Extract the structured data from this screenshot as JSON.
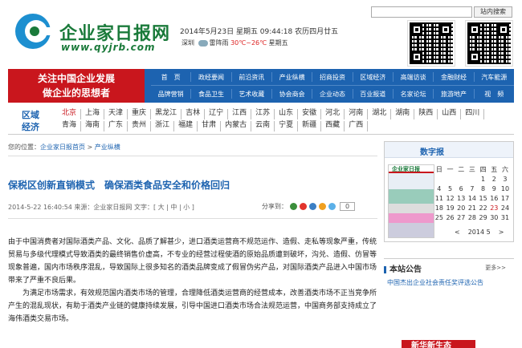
{
  "header": {
    "logo_title": "企业家日报网",
    "logo_url": "www.qyjrb.com",
    "date_line": "2014年5月23日 星期五 09:44:18 农历四月廿五",
    "weather_city": "深圳",
    "weather_desc": "雷阵雨",
    "weather_temp": "30℃~26℃",
    "weather_day": "星期五",
    "search_placeholder": "",
    "search_button": "站内搜索"
  },
  "nav": {
    "slogan_line1": "关注中国企业发展",
    "slogan_line2": "做企业的思想者",
    "row1": [
      "首　页",
      "政经要闻",
      "前沿资讯",
      "产业纵横",
      "招商投资",
      "区域经济",
      "高端访谈",
      "金融财经",
      "汽车能源"
    ],
    "row2": [
      "品牌营销",
      "食品卫生",
      "艺术收藏",
      "协会商会",
      "企业动态",
      "百业报道",
      "名家论坛",
      "旅游地产",
      "视　频"
    ]
  },
  "region": {
    "label_line1": "区域",
    "label_line2": "经济",
    "row1": [
      "北京",
      "上海",
      "天津",
      "重庆",
      "黑龙江",
      "吉林",
      "辽宁",
      "江西",
      "江苏",
      "山东",
      "安徽",
      "河北",
      "河南",
      "湖北",
      "湖南",
      "陕西",
      "山西",
      "四川"
    ],
    "row2": [
      "青海",
      "海南",
      "广东",
      "贵州",
      "浙江",
      "福建",
      "甘肃",
      "内蒙古",
      "云南",
      "宁夏",
      "新疆",
      "西藏",
      "广西"
    ]
  },
  "breadcrumb": {
    "prefix": "您的位置：",
    "home": "企业家日报首页",
    "sep": " > ",
    "section": "产业纵横"
  },
  "article": {
    "title": "保税区创新直销模式　确保酒类食品安全和价格回归",
    "meta": "2014-5-22 16:40:54 来源：企业家日报网 文字：[ 大 | 中 | 小 ]",
    "share_label": "分享到：",
    "share_count": "0",
    "paragraphs": [
      "由于中国消费者对国际酒类产品、文化、品质了解甚少，进口酒类运营商不规范运作、造假、走私等现象严重，传统贸易与多级代理模式导致酒类的最终销售价虚高，不专业的经营过程使酒的原始品质遭到破坏，沟兑、造假、仿冒等现象普遍，国内市场秩序混乱，导致国际上很多知名的酒类品牌变成了假冒伪劣产品，对国际酒类产品进入中国市场带来了严重不良后果。",
      "为满足市场需求，有效规范国内酒类市场的管理，合理降低酒类运营商的经营成本，改善酒类市场不正当竞争所产生的混乱现状，有助于酒类产业链的健康持续发展，引导中国进口酒类市场合法规范运营，中国商务部支持成立了海伟酒类交易市场。"
    ]
  },
  "sidebar": {
    "paper_title": "数字报",
    "paper_thumb_title": "企业家日报",
    "calendar": {
      "weekdays": [
        "日",
        "一",
        "二",
        "三",
        "四",
        "五",
        "六"
      ],
      "weeks": [
        [
          "",
          "",
          "",
          "",
          "1",
          "2",
          "3"
        ],
        [
          "4",
          "5",
          "6",
          "7",
          "8",
          "9",
          "10"
        ],
        [
          "11",
          "12",
          "13",
          "14",
          "15",
          "16",
          "17"
        ],
        [
          "18",
          "19",
          "20",
          "21",
          "22",
          "23",
          "24"
        ],
        [
          "25",
          "26",
          "27",
          "28",
          "29",
          "30",
          "31"
        ]
      ],
      "highlight_day": "23",
      "prev": "<",
      "year_month": "2014 5",
      "next": ">"
    },
    "notice_title": "本站公告",
    "notice_more": "更多>>",
    "notice_item": "中国杰出企业社会责任奖评选公告",
    "banner_text": "新华新生态"
  },
  "colors": {
    "brand_green": "#1a7a3a",
    "nav_blue": "#1d63b0",
    "slogan_red": "#c9161d"
  }
}
